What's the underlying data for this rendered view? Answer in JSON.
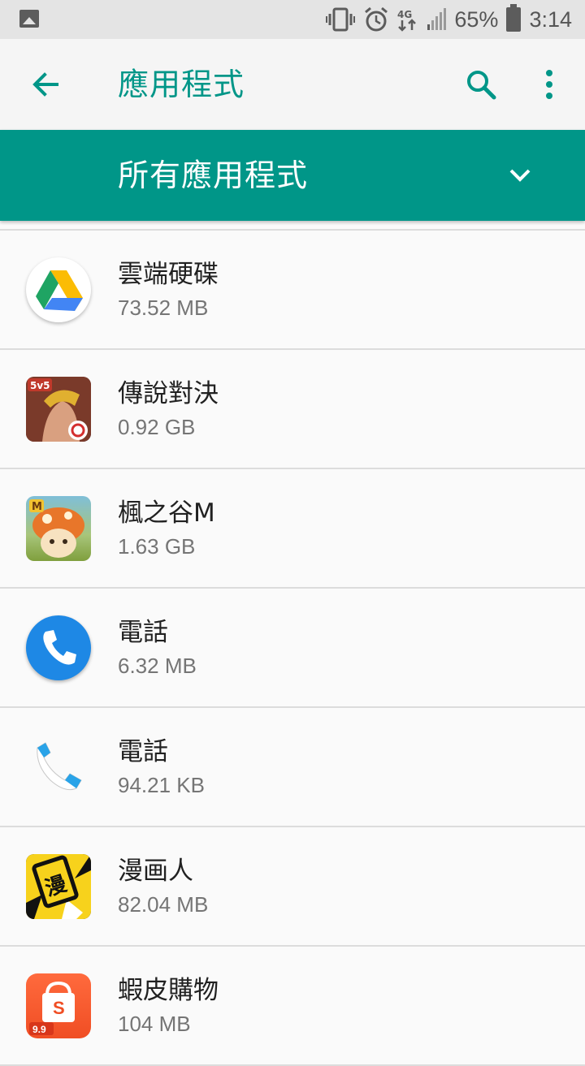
{
  "status_bar": {
    "battery_percent": "65%",
    "time": "3:14",
    "network_label": "4G"
  },
  "app_bar": {
    "title": "應用程式"
  },
  "filter": {
    "label": "所有應用程式"
  },
  "apps": [
    {
      "name": "雲端硬碟",
      "size": "73.52 MB",
      "icon": "google-drive-icon"
    },
    {
      "name": "傳說對決",
      "size": "0.92 GB",
      "icon": "arena-of-valor-icon"
    },
    {
      "name": "楓之谷M",
      "size": "1.63 GB",
      "icon": "maplestory-m-icon"
    },
    {
      "name": "電話",
      "size": "6.32 MB",
      "icon": "phone-app-icon"
    },
    {
      "name": "電話",
      "size": "94.21 KB",
      "icon": "phone-handset-icon"
    },
    {
      "name": "漫画人",
      "size": "82.04 MB",
      "icon": "manhuaren-icon"
    },
    {
      "name": "蝦皮購物",
      "size": "104 MB",
      "icon": "shopee-icon"
    }
  ],
  "colors": {
    "accent": "#009688",
    "app_bar_bg": "#f5f5f5",
    "status_bar_bg": "#e4e4e4"
  }
}
